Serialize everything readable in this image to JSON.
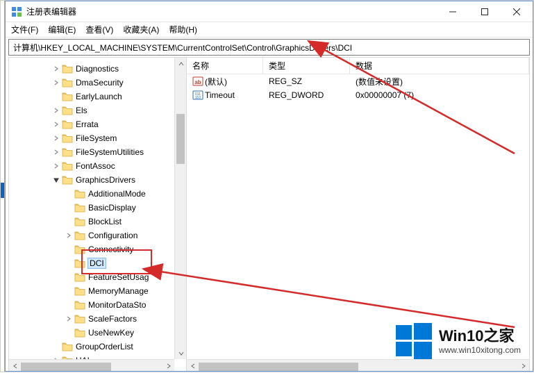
{
  "window": {
    "title": "注册表编辑器"
  },
  "menu": {
    "file": "文件(F)",
    "edit": "编辑(E)",
    "view": "查看(V)",
    "favorites": "收藏夹(A)",
    "help": "帮助(H)"
  },
  "address": "计算机\\HKEY_LOCAL_MACHINE\\SYSTEM\\CurrentControlSet\\Control\\GraphicsDrivers\\DCI",
  "tree": {
    "items": [
      {
        "label": "Diagnostics",
        "depth": 4,
        "expand": "closed"
      },
      {
        "label": "DmaSecurity",
        "depth": 4,
        "expand": "closed"
      },
      {
        "label": "EarlyLaunch",
        "depth": 4,
        "expand": "none"
      },
      {
        "label": "Els",
        "depth": 4,
        "expand": "closed"
      },
      {
        "label": "Errata",
        "depth": 4,
        "expand": "closed"
      },
      {
        "label": "FileSystem",
        "depth": 4,
        "expand": "closed"
      },
      {
        "label": "FileSystemUtilities",
        "depth": 4,
        "expand": "closed"
      },
      {
        "label": "FontAssoc",
        "depth": 4,
        "expand": "closed"
      },
      {
        "label": "GraphicsDrivers",
        "depth": 4,
        "expand": "open"
      },
      {
        "label": "AdditionalMode",
        "depth": 5,
        "expand": "none"
      },
      {
        "label": "BasicDisplay",
        "depth": 5,
        "expand": "none"
      },
      {
        "label": "BlockList",
        "depth": 5,
        "expand": "none"
      },
      {
        "label": "Configuration",
        "depth": 5,
        "expand": "closed"
      },
      {
        "label": "Connectivity",
        "depth": 5,
        "expand": "none"
      },
      {
        "label": "DCI",
        "depth": 5,
        "expand": "none",
        "selected": true
      },
      {
        "label": "FeatureSetUsag",
        "depth": 5,
        "expand": "none"
      },
      {
        "label": "MemoryManage",
        "depth": 5,
        "expand": "none"
      },
      {
        "label": "MonitorDataSto",
        "depth": 5,
        "expand": "none"
      },
      {
        "label": "ScaleFactors",
        "depth": 5,
        "expand": "closed"
      },
      {
        "label": "UseNewKey",
        "depth": 5,
        "expand": "none"
      },
      {
        "label": "GroupOrderList",
        "depth": 4,
        "expand": "none"
      },
      {
        "label": "HAL",
        "depth": 4,
        "expand": "closed"
      }
    ]
  },
  "list": {
    "headers": {
      "name": "名称",
      "type": "类型",
      "data": "数据"
    },
    "rows": [
      {
        "icon": "string-value-icon",
        "name": "(默认)",
        "type": "REG_SZ",
        "data": "(数值未设置)"
      },
      {
        "icon": "binary-value-icon",
        "name": "Timeout",
        "type": "REG_DWORD",
        "data": "0x00000007 (7)"
      }
    ]
  },
  "watermark": {
    "title": "Win10之家",
    "url": "www.win10xitong.com"
  }
}
